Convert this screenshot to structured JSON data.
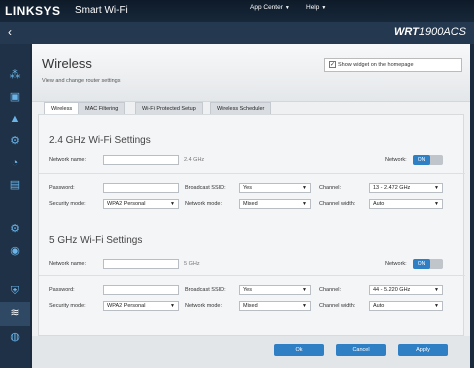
{
  "header": {
    "brand": "LINKSYS",
    "brand_sub": "Smart Wi-Fi",
    "nav": [
      {
        "label": "App Center"
      },
      {
        "label": "Help"
      }
    ],
    "model_prefix": "WRT",
    "model_suffix": "1900ACS"
  },
  "page": {
    "title": "Wireless",
    "subtitle": "View and change router settings",
    "widget_label": "Show widget on the homepage",
    "widget_checked": true
  },
  "tabs": [
    {
      "label": "Wireless",
      "active": true
    },
    {
      "label": "MAC Filtering",
      "active": false
    },
    {
      "label": "Wi-Fi Protected Setup",
      "active": false
    },
    {
      "label": "Wireless Scheduler",
      "active": false
    }
  ],
  "sections": [
    {
      "title": "2.4 GHz Wi-Fi Settings",
      "network_name_label": "Network name:",
      "network_name_value": "",
      "band_hint": "2.4 GHz",
      "network_label": "Network:",
      "network_toggle": "ON",
      "password_label": "Password:",
      "password_value": "",
      "broadcast_label": "Broadcast SSID:",
      "broadcast_value": "Yes",
      "channel_label": "Channel:",
      "channel_value": "13 - 2.472 GHz",
      "security_label": "Security mode:",
      "security_value": "WPA2 Personal",
      "mode_label": "Network mode:",
      "mode_value": "Mixed",
      "width_label": "Channel width:",
      "width_value": "Auto"
    },
    {
      "title": "5 GHz Wi-Fi Settings",
      "network_name_label": "Network name:",
      "network_name_value": "",
      "band_hint": "5 GHz",
      "network_label": "Network:",
      "network_toggle": "ON",
      "password_label": "Password:",
      "password_value": "",
      "broadcast_label": "Broadcast SSID:",
      "broadcast_value": "Yes",
      "channel_label": "Channel:",
      "channel_value": "44 - 5.220 GHz",
      "security_label": "Security mode:",
      "security_value": "WPA2 Personal",
      "mode_label": "Network mode:",
      "mode_value": "Mixed",
      "width_label": "Channel width:",
      "width_value": "Auto"
    }
  ],
  "footer": {
    "ok": "Ok",
    "cancel": "Cancel",
    "apply": "Apply"
  },
  "colors": {
    "accent": "#2f7fc4",
    "rail_icon": "#6ab4e8",
    "header_bg": "#17283a"
  },
  "rail_icons": [
    "network-map-icon",
    "device-list-icon",
    "alert-icon",
    "media-prioritization-icon",
    "speed-test-icon",
    "parental-controls-icon",
    "connectivity-icon",
    "external-storage-icon",
    "wireless-icon",
    "security-icon",
    "troubleshooting-icon"
  ]
}
